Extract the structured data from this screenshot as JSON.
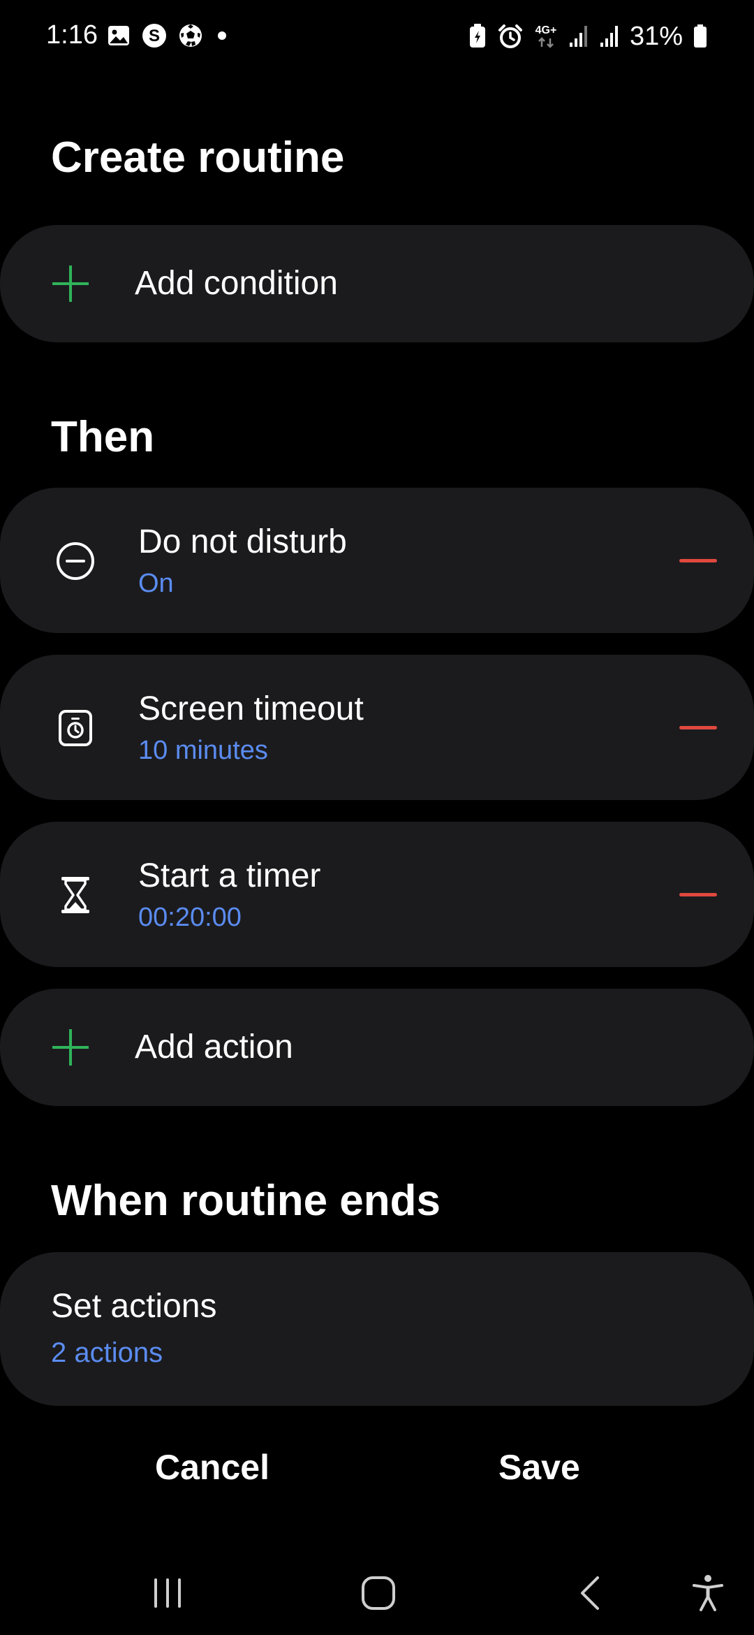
{
  "status_bar": {
    "time": "1:16",
    "left_icons": [
      "gallery-icon",
      "s-app-icon",
      "soccer-ball-icon",
      "dot-icon"
    ],
    "right_icons": [
      "battery-saver-icon",
      "alarm-icon",
      "network-4g-icon",
      "signal-icon",
      "signal-icon"
    ],
    "network_label": "4G+",
    "battery_percent": "31%"
  },
  "header": {
    "title": "Create routine"
  },
  "conditions": {
    "add_label": "Add condition"
  },
  "then": {
    "heading": "Then",
    "actions": [
      {
        "icon": "do-not-disturb-icon",
        "title": "Do not disturb",
        "value": "On"
      },
      {
        "icon": "screen-timeout-icon",
        "title": "Screen timeout",
        "value": "10 minutes"
      },
      {
        "icon": "hourglass-icon",
        "title": "Start a timer",
        "value": "00:20:00"
      }
    ],
    "add_label": "Add action"
  },
  "ends": {
    "heading": "When routine ends",
    "title": "Set actions",
    "value": "2 actions"
  },
  "footer": {
    "cancel_label": "Cancel",
    "save_label": "Save"
  },
  "nav": {
    "items": [
      "recents-icon",
      "home-icon",
      "back-icon",
      "accessibility-icon"
    ]
  },
  "colors": {
    "background": "#000000",
    "card": "#1b1b1e",
    "accent_green": "#2fb45a",
    "accent_blue": "#5b8cf0",
    "remove_red": "#e0483e"
  }
}
